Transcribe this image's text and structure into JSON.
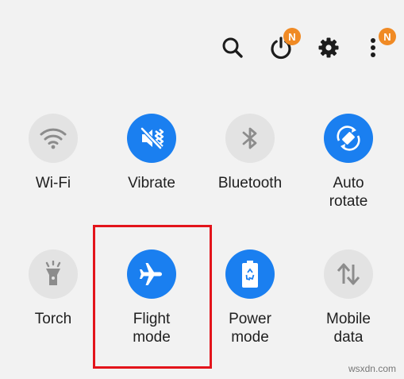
{
  "header": {
    "notification_badge": "N",
    "more_badge": "N"
  },
  "tiles": [
    {
      "label": "Wi-Fi",
      "icon": "wifi-icon",
      "state": "off"
    },
    {
      "label": "Vibrate",
      "icon": "vibrate-icon",
      "state": "on"
    },
    {
      "label": "Bluetooth",
      "icon": "bluetooth-icon",
      "state": "off"
    },
    {
      "label": "Auto\nrotate",
      "icon": "auto-rotate-icon",
      "state": "on"
    },
    {
      "label": "Torch",
      "icon": "torch-icon",
      "state": "off"
    },
    {
      "label": "Flight\nmode",
      "icon": "airplane-icon",
      "state": "on"
    },
    {
      "label": "Power\nmode",
      "icon": "battery-icon",
      "state": "on"
    },
    {
      "label": "Mobile\ndata",
      "icon": "mobile-data-icon",
      "state": "off"
    }
  ],
  "watermark": "wsxdn.com",
  "colors": {
    "active": "#1a7ff0",
    "inactive": "#e3e3e3",
    "badge": "#f08a24",
    "highlight": "#e3141b"
  }
}
